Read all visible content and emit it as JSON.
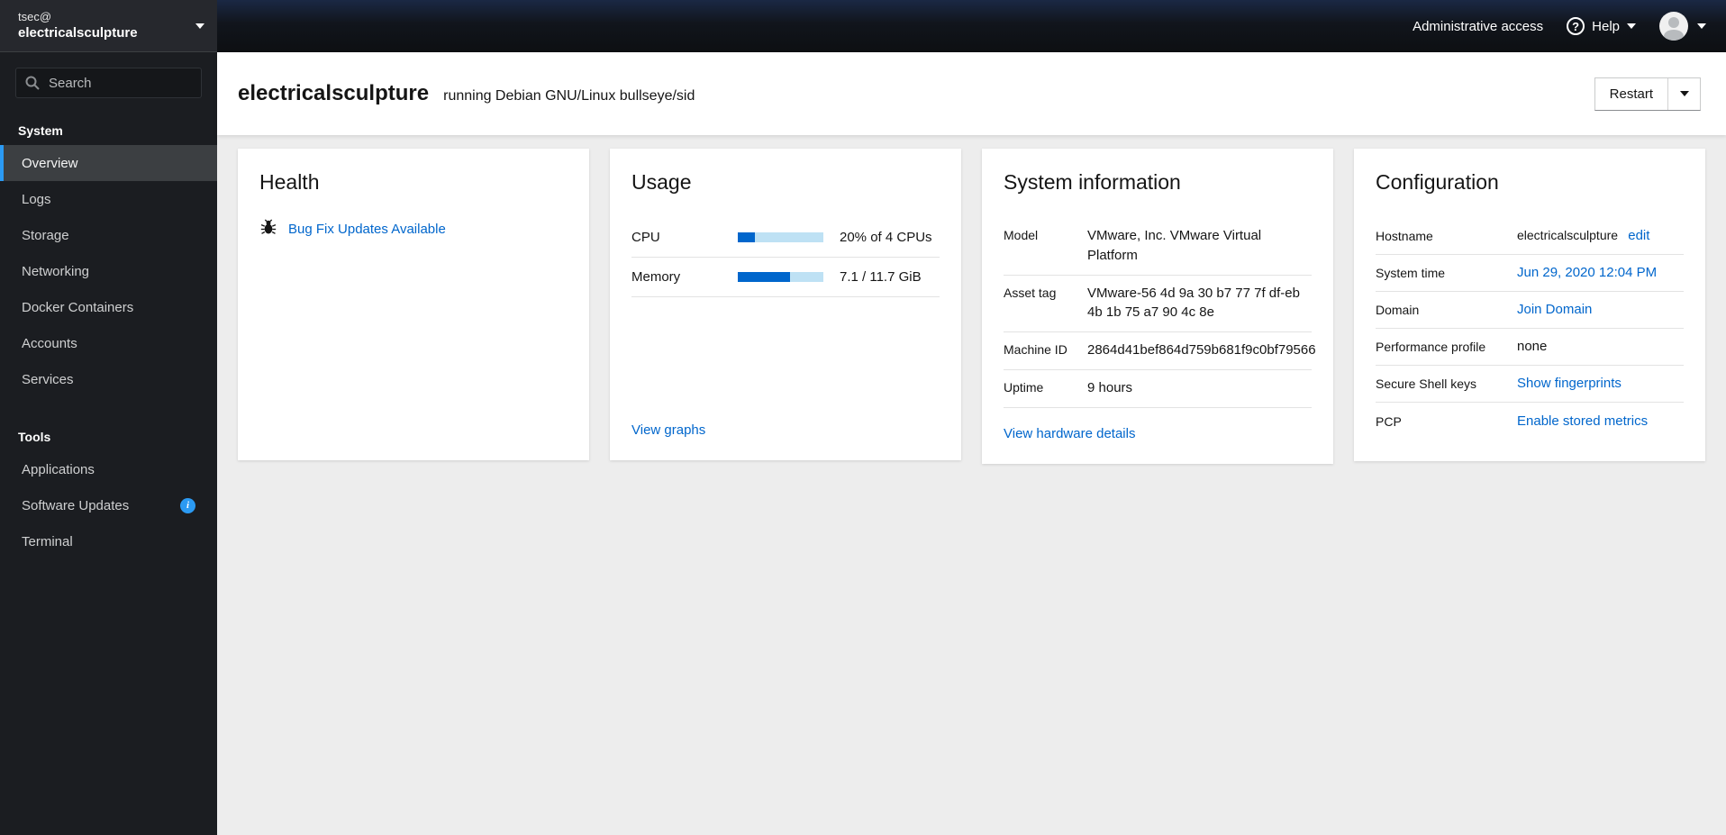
{
  "masthead": {
    "admin_access_label": "Administrative access",
    "help_label": "Help",
    "help_icon_glyph": "?"
  },
  "sidebar": {
    "user": "tsec@",
    "host": "electricalsculpture",
    "search_placeholder": "Search",
    "sections": [
      {
        "label": "System",
        "items": [
          {
            "label": "Overview"
          },
          {
            "label": "Logs"
          },
          {
            "label": "Storage"
          },
          {
            "label": "Networking"
          },
          {
            "label": "Docker Containers"
          },
          {
            "label": "Accounts"
          },
          {
            "label": "Services"
          }
        ]
      },
      {
        "label": "Tools",
        "items": [
          {
            "label": "Applications"
          },
          {
            "label": "Software Updates",
            "badge_glyph": "i"
          },
          {
            "label": "Terminal"
          }
        ]
      }
    ]
  },
  "header": {
    "hostname": "electricalsculpture",
    "os_text": "running Debian GNU/Linux bullseye/sid",
    "restart_label": "Restart"
  },
  "cards": {
    "health": {
      "title": "Health",
      "updates_link": "Bug Fix Updates Available"
    },
    "usage": {
      "title": "Usage",
      "rows": [
        {
          "label": "CPU",
          "percent": 20,
          "value": "20% of 4 CPUs"
        },
        {
          "label": "Memory",
          "percent": 61,
          "value": "7.1 / 11.7 GiB"
        }
      ],
      "link": "View graphs"
    },
    "system_info": {
      "title": "System information",
      "rows": [
        {
          "label": "Model",
          "value": "VMware, Inc. VMware Virtual Platform"
        },
        {
          "label": "Asset tag",
          "value": "VMware-56 4d 9a 30 b7 77 7f df-eb 4b 1b 75 a7 90 4c 8e"
        },
        {
          "label": "Machine ID",
          "value": "2864d41bef864d759b681f9c0bf79566"
        },
        {
          "label": "Uptime",
          "value": "9 hours"
        }
      ],
      "link": "View hardware details"
    },
    "configuration": {
      "title": "Configuration",
      "rows": [
        {
          "label": "Hostname",
          "value": "electricalsculpture",
          "link": "edit"
        },
        {
          "label": "System time",
          "link": "Jun 29, 2020 12:04 PM"
        },
        {
          "label": "Domain",
          "link": "Join Domain"
        },
        {
          "label": "Performance profile",
          "value": "none"
        },
        {
          "label": "Secure Shell keys",
          "link": "Show fingerprints"
        },
        {
          "label": "PCP",
          "link": "Enable stored metrics"
        }
      ]
    }
  },
  "colors": {
    "link_blue": "#0066cc",
    "selected_nav_accent": "#2b9af3",
    "info_badge": "#2b9af3",
    "progress_fill": "#0066cc",
    "progress_track": "#bee1f4",
    "sidebar_bg": "#1b1d21",
    "masthead_bg": "#0d0f12"
  }
}
